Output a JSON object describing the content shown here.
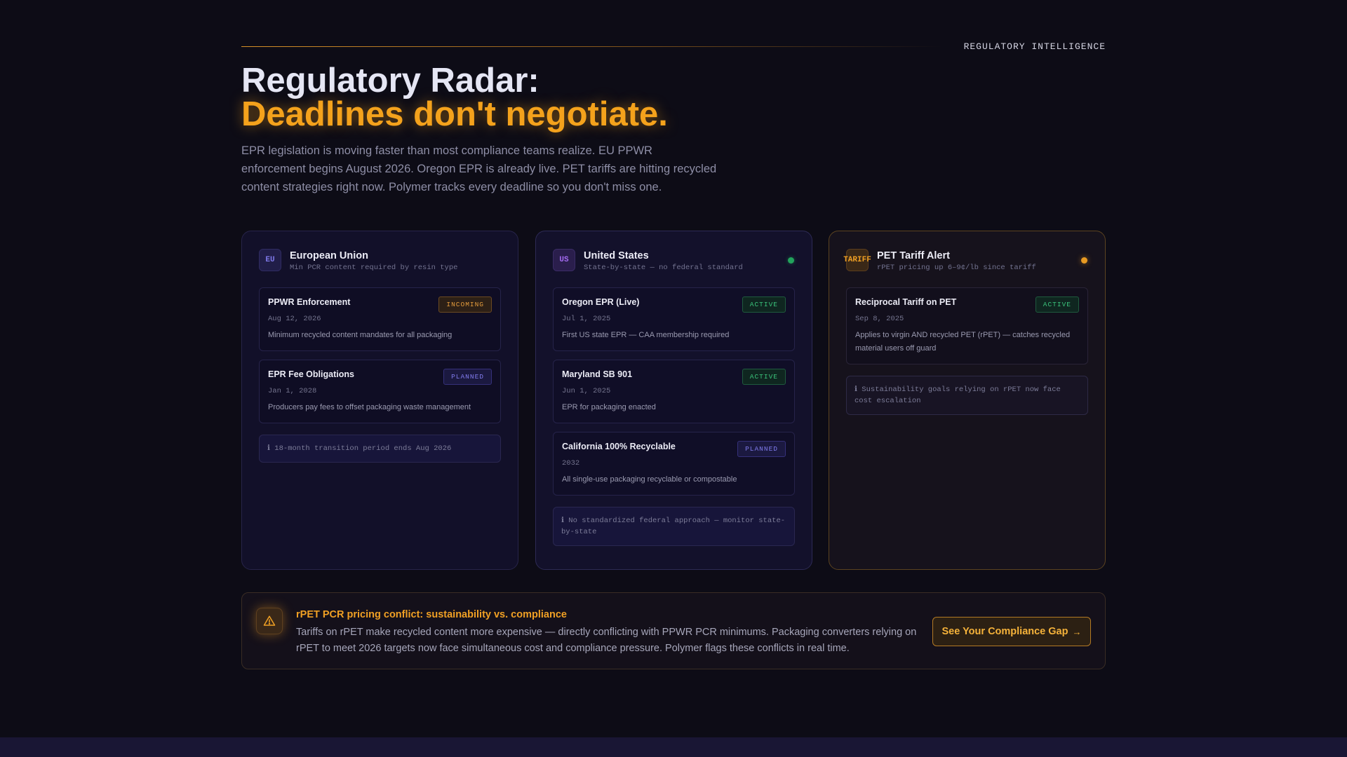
{
  "header": {
    "kicker": "REGULATORY INTELLIGENCE",
    "title_line1": "Regulatory Radar:",
    "title_line2": "Deadlines don't negotiate.",
    "lead": "EPR legislation is moving faster than most compliance teams realize. EU PPWR enforcement begins August 2026. Oregon EPR is already live. PET tariffs are hitting recycled content strategies right now. Polymer tracks every deadline so you don't miss one."
  },
  "cards": {
    "eu": {
      "badge": "EU",
      "name": "European Union",
      "subtitle": "Min PCR content required by resin type",
      "items": [
        {
          "title": "PPWR Enforcement",
          "tag": "INCOMING",
          "date": "Aug 12, 2026",
          "desc": "Minimum recycled content mandates for all packaging"
        },
        {
          "title": "EPR Fee Obligations",
          "tag": "PLANNED",
          "date": "Jan 1, 2028",
          "desc": "Producers pay fees to offset packaging waste management"
        }
      ],
      "note": "ℹ 18-month transition period ends Aug 2026"
    },
    "us": {
      "badge": "US",
      "name": "United States",
      "subtitle": "State-by-state — no federal standard",
      "items": [
        {
          "title": "Oregon EPR (Live)",
          "tag": "ACTIVE",
          "date": "Jul 1, 2025",
          "desc": "First US state EPR — CAA membership required"
        },
        {
          "title": "Maryland SB 901",
          "tag": "ACTIVE",
          "date": "Jun 1, 2025",
          "desc": "EPR for packaging enacted"
        },
        {
          "title": "California 100% Recyclable",
          "tag": "PLANNED",
          "date": "2032",
          "desc": "All single-use packaging recyclable or compostable"
        }
      ],
      "note": "ℹ No standardized federal approach — monitor state-by-state"
    },
    "tariff": {
      "badge": "TARIFF",
      "name": "PET Tariff Alert",
      "subtitle": "rPET pricing up 6–9¢/lb since tariff",
      "items": [
        {
          "title": "Reciprocal Tariff on PET",
          "tag": "ACTIVE",
          "date": "Sep 8, 2025",
          "desc": "Applies to virgin AND recycled PET (rPET) — catches recycled material users off guard"
        }
      ],
      "note": "ℹ Sustainability goals relying on rPET now face cost escalation"
    }
  },
  "alert": {
    "icon": "warning-triangle-icon",
    "title": "rPET PCR pricing conflict: sustainability vs. compliance",
    "text": "Tariffs on rPET make recycled content more expensive — directly conflicting with PPWR PCR minimums. Packaging converters relying on rPET to meet 2026 targets now face simultaneous cost and compliance pressure. Polymer flags these conflicts in real time.",
    "cta_label": "See Your Compliance Gap",
    "cta_arrow": "→"
  },
  "colors": {
    "background": "#0d0c16",
    "accent": "#f4a21c",
    "active": "#3ac27a",
    "planned": "#7f79ea",
    "incoming": "#e29a3c"
  }
}
